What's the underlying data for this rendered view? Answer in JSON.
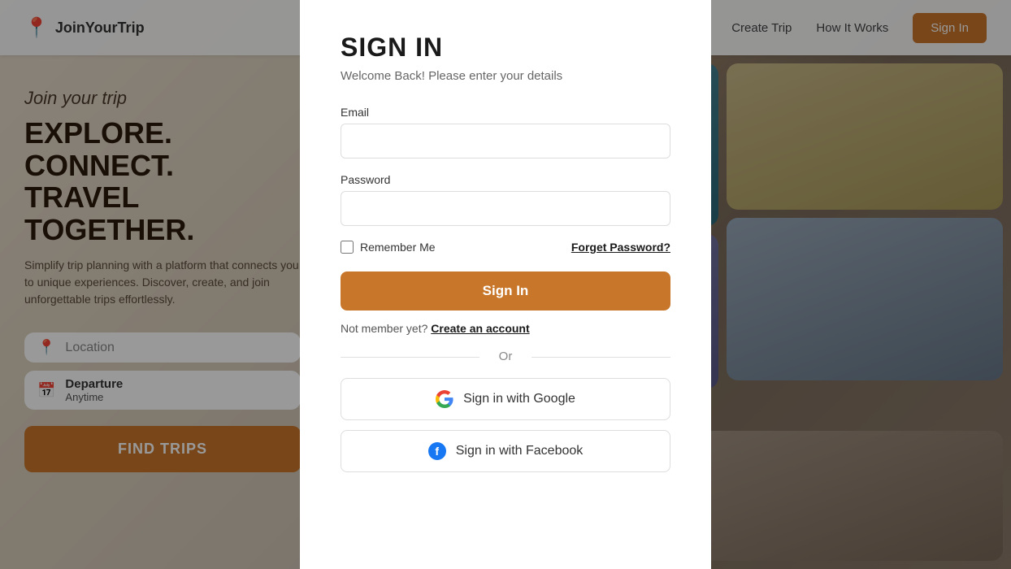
{
  "navbar": {
    "logo_text": "JoinYourTrip",
    "nav_create": "Create Trip",
    "nav_how": "How It Works",
    "nav_signin": "Sign In"
  },
  "hero": {
    "join_italic": "Join your trip",
    "title_line1": "EXPLORE. CONNECT.",
    "title_line2": "TRAVEL TOGETHER.",
    "description": "Simplify trip planning with a platform that connects you to unique experiences. Discover, create, and join unforgettable trips effortlessly.",
    "location_placeholder": "Location",
    "departure_label": "Departure",
    "departure_sub": "Anytime",
    "find_trips": "FIND TRIPS"
  },
  "modal": {
    "title": "SIGN IN",
    "subtitle": "Welcome Back! Please enter your details",
    "email_label": "Email",
    "email_placeholder": "",
    "password_label": "Password",
    "password_placeholder": "",
    "remember_label": "Remember Me",
    "forget_label": "Forget Password?",
    "signin_btn": "Sign In",
    "not_member": "Not member yet?",
    "create_account": "Create an account",
    "or": "Or",
    "google_btn": "Sign in with Google",
    "facebook_btn": "Sign in with Facebook"
  }
}
